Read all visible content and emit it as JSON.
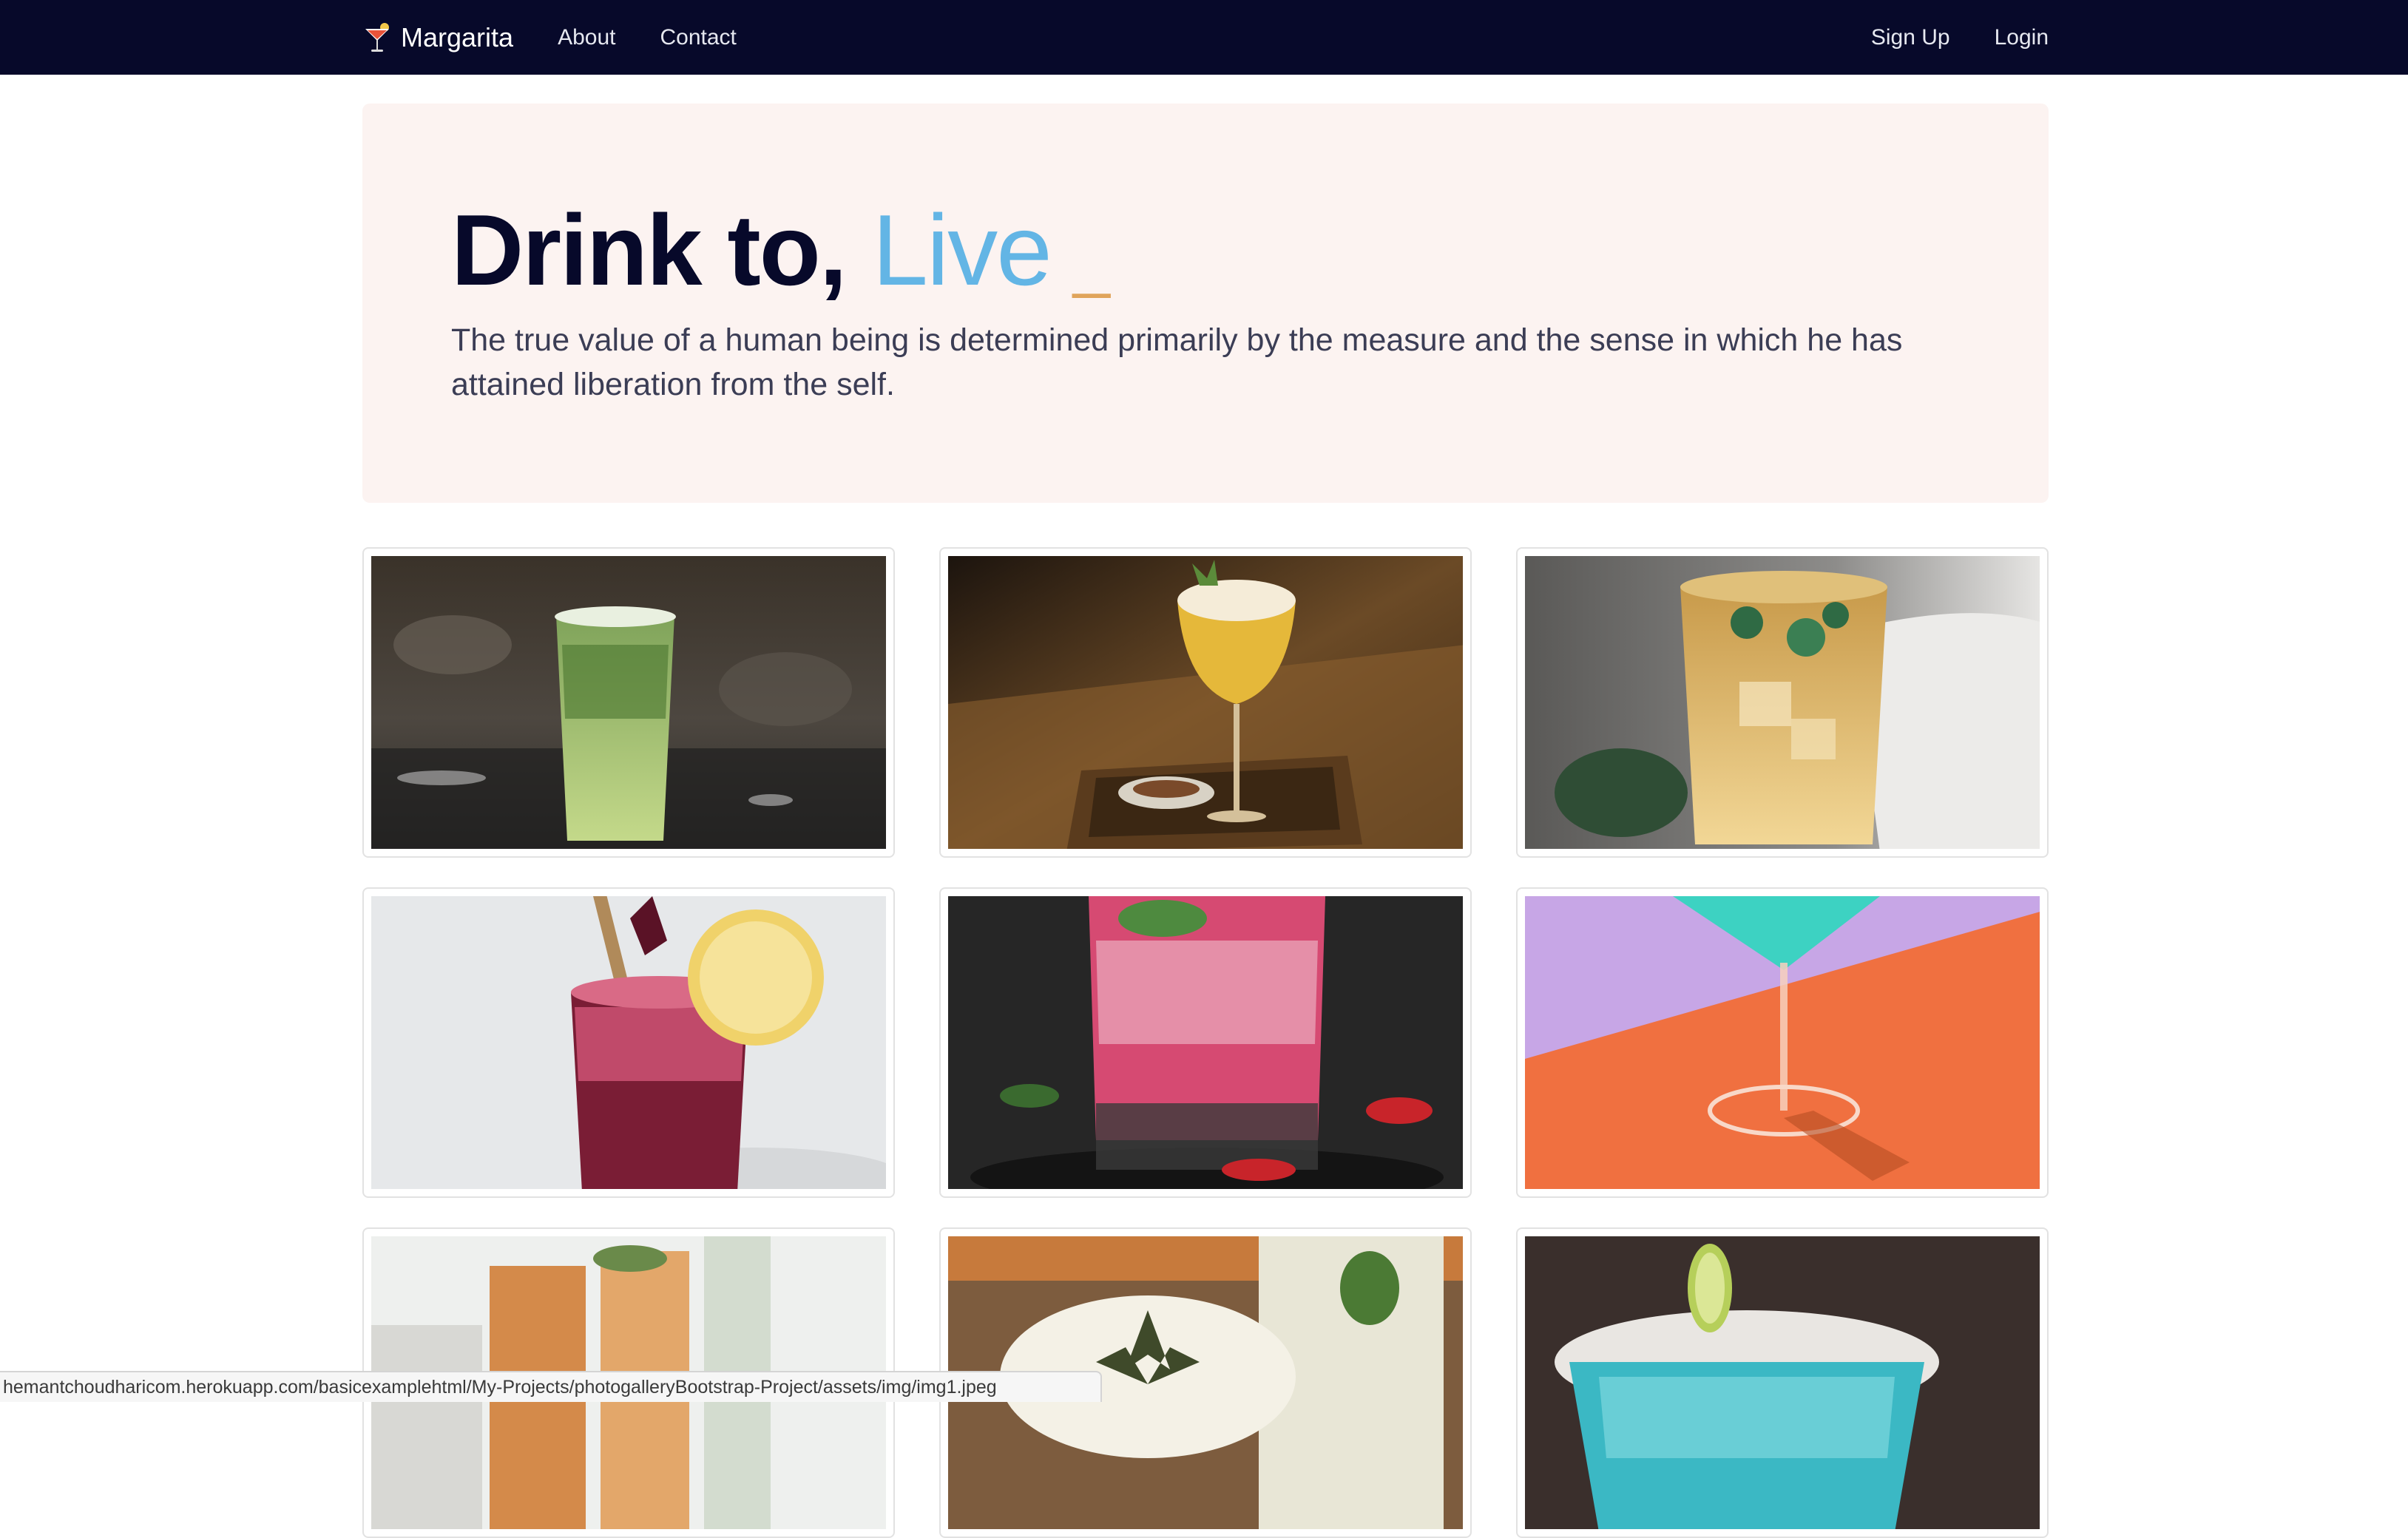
{
  "navbar": {
    "brand": "Margarita",
    "links": [
      "About",
      "Contact"
    ],
    "right_links": [
      "Sign Up",
      "Login"
    ],
    "icon": "cocktail-glass-icon"
  },
  "hero": {
    "title_prefix": "Drink to, ",
    "title_highlight": "Live",
    "title_cursor": "_",
    "lead": "The true value of a human being is determined primarily by the measure and the sense in which he has attained liberation from the self."
  },
  "gallery": {
    "images": [
      {
        "subject": "green mojito glass on dark bar"
      },
      {
        "subject": "yellow foamy cocktail on wooden tray"
      },
      {
        "subject": "amber iced drink with mint"
      },
      {
        "subject": "red berry slush in jar with lemon"
      },
      {
        "subject": "pink sparkling drink with peppers"
      },
      {
        "subject": "blue martini on orange and lilac"
      },
      {
        "subject": "iced tea glasses"
      },
      {
        "subject": "latte with leaf art"
      },
      {
        "subject": "turquoise cocktail with lime"
      }
    ]
  },
  "status": {
    "url": "hemantchoudharicom.herokuapp.com/basicexamplehtml/My-Projects/photogalleryBootstrap-Project/assets/img/img1.jpeg"
  },
  "colors": {
    "navbar_bg": "#07092a",
    "accent_blue": "#63b5e5",
    "cursor_orange": "#e0a45b",
    "hero_bg": "#fcf3f1"
  }
}
